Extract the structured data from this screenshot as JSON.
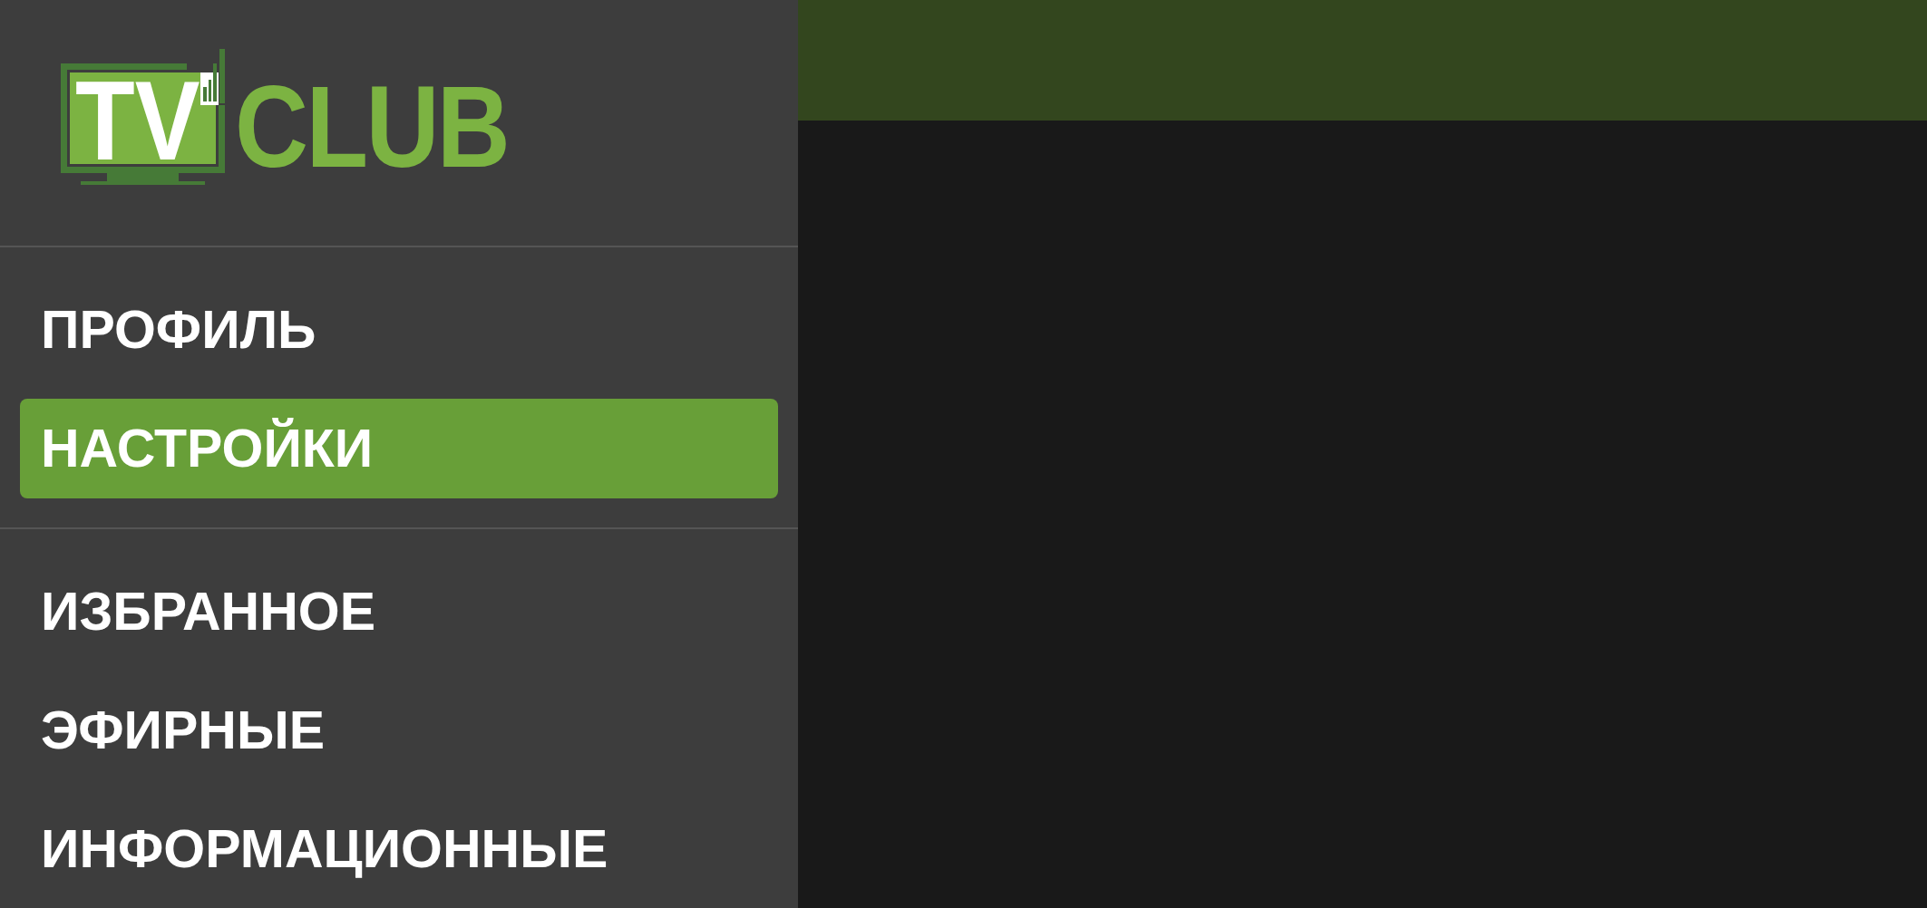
{
  "sidebar": {
    "logo": {
      "screen_text": "TV",
      "wordmark": "CLUB"
    },
    "sections": [
      {
        "items": [
          {
            "label": "ПРОФИЛЬ",
            "selected": false
          },
          {
            "label": "НАСТРОЙКИ",
            "selected": true
          }
        ]
      },
      {
        "items": [
          {
            "label": "ИЗБРАННОЕ",
            "selected": false
          },
          {
            "label": "ЭФИРНЫЕ",
            "selected": false
          },
          {
            "label": "ИНФОРМАЦИОННЫЕ",
            "selected": false
          }
        ]
      }
    ]
  }
}
